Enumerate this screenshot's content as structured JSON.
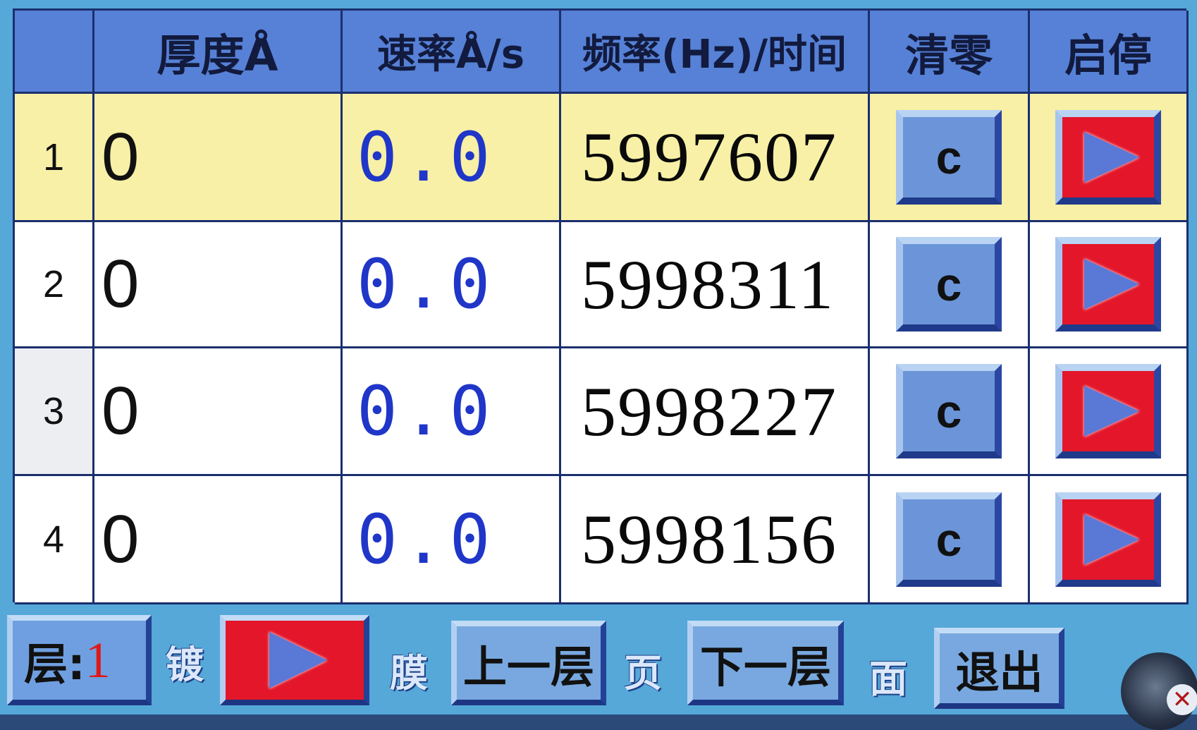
{
  "table": {
    "headers": [
      "",
      "厚度Å",
      "速率Å/s",
      "频率(Hz)/时间",
      "清零",
      "启停"
    ],
    "rows": [
      {
        "index": "1",
        "thickness": "0",
        "rate": "0.0",
        "frequency": "5997607",
        "clear_label": "c"
      },
      {
        "index": "2",
        "thickness": "0",
        "rate": "0.0",
        "frequency": "5998311",
        "clear_label": "c"
      },
      {
        "index": "3",
        "thickness": "0",
        "rate": "0.0",
        "frequency": "5998227",
        "clear_label": "c"
      },
      {
        "index": "4",
        "thickness": "0",
        "rate": "0.0",
        "frequency": "5998156",
        "clear_label": "c"
      }
    ]
  },
  "bottom": {
    "layer_label": "层:",
    "layer_value": "1",
    "label_plating": "镀",
    "label_film": "膜",
    "prev_layer": "上一层",
    "label_page": "页",
    "next_layer": "下一层",
    "label_face": "面",
    "exit": "退出"
  },
  "icons": {
    "start_stop": "play-icon",
    "corner": "close-icon"
  },
  "colors": {
    "header_bg": "#5681d6",
    "active_row_bg": "#f7f0a6",
    "rate_text": "#2036c8",
    "play_button_bg": "#e3162a",
    "layer_value": "#e01818"
  }
}
